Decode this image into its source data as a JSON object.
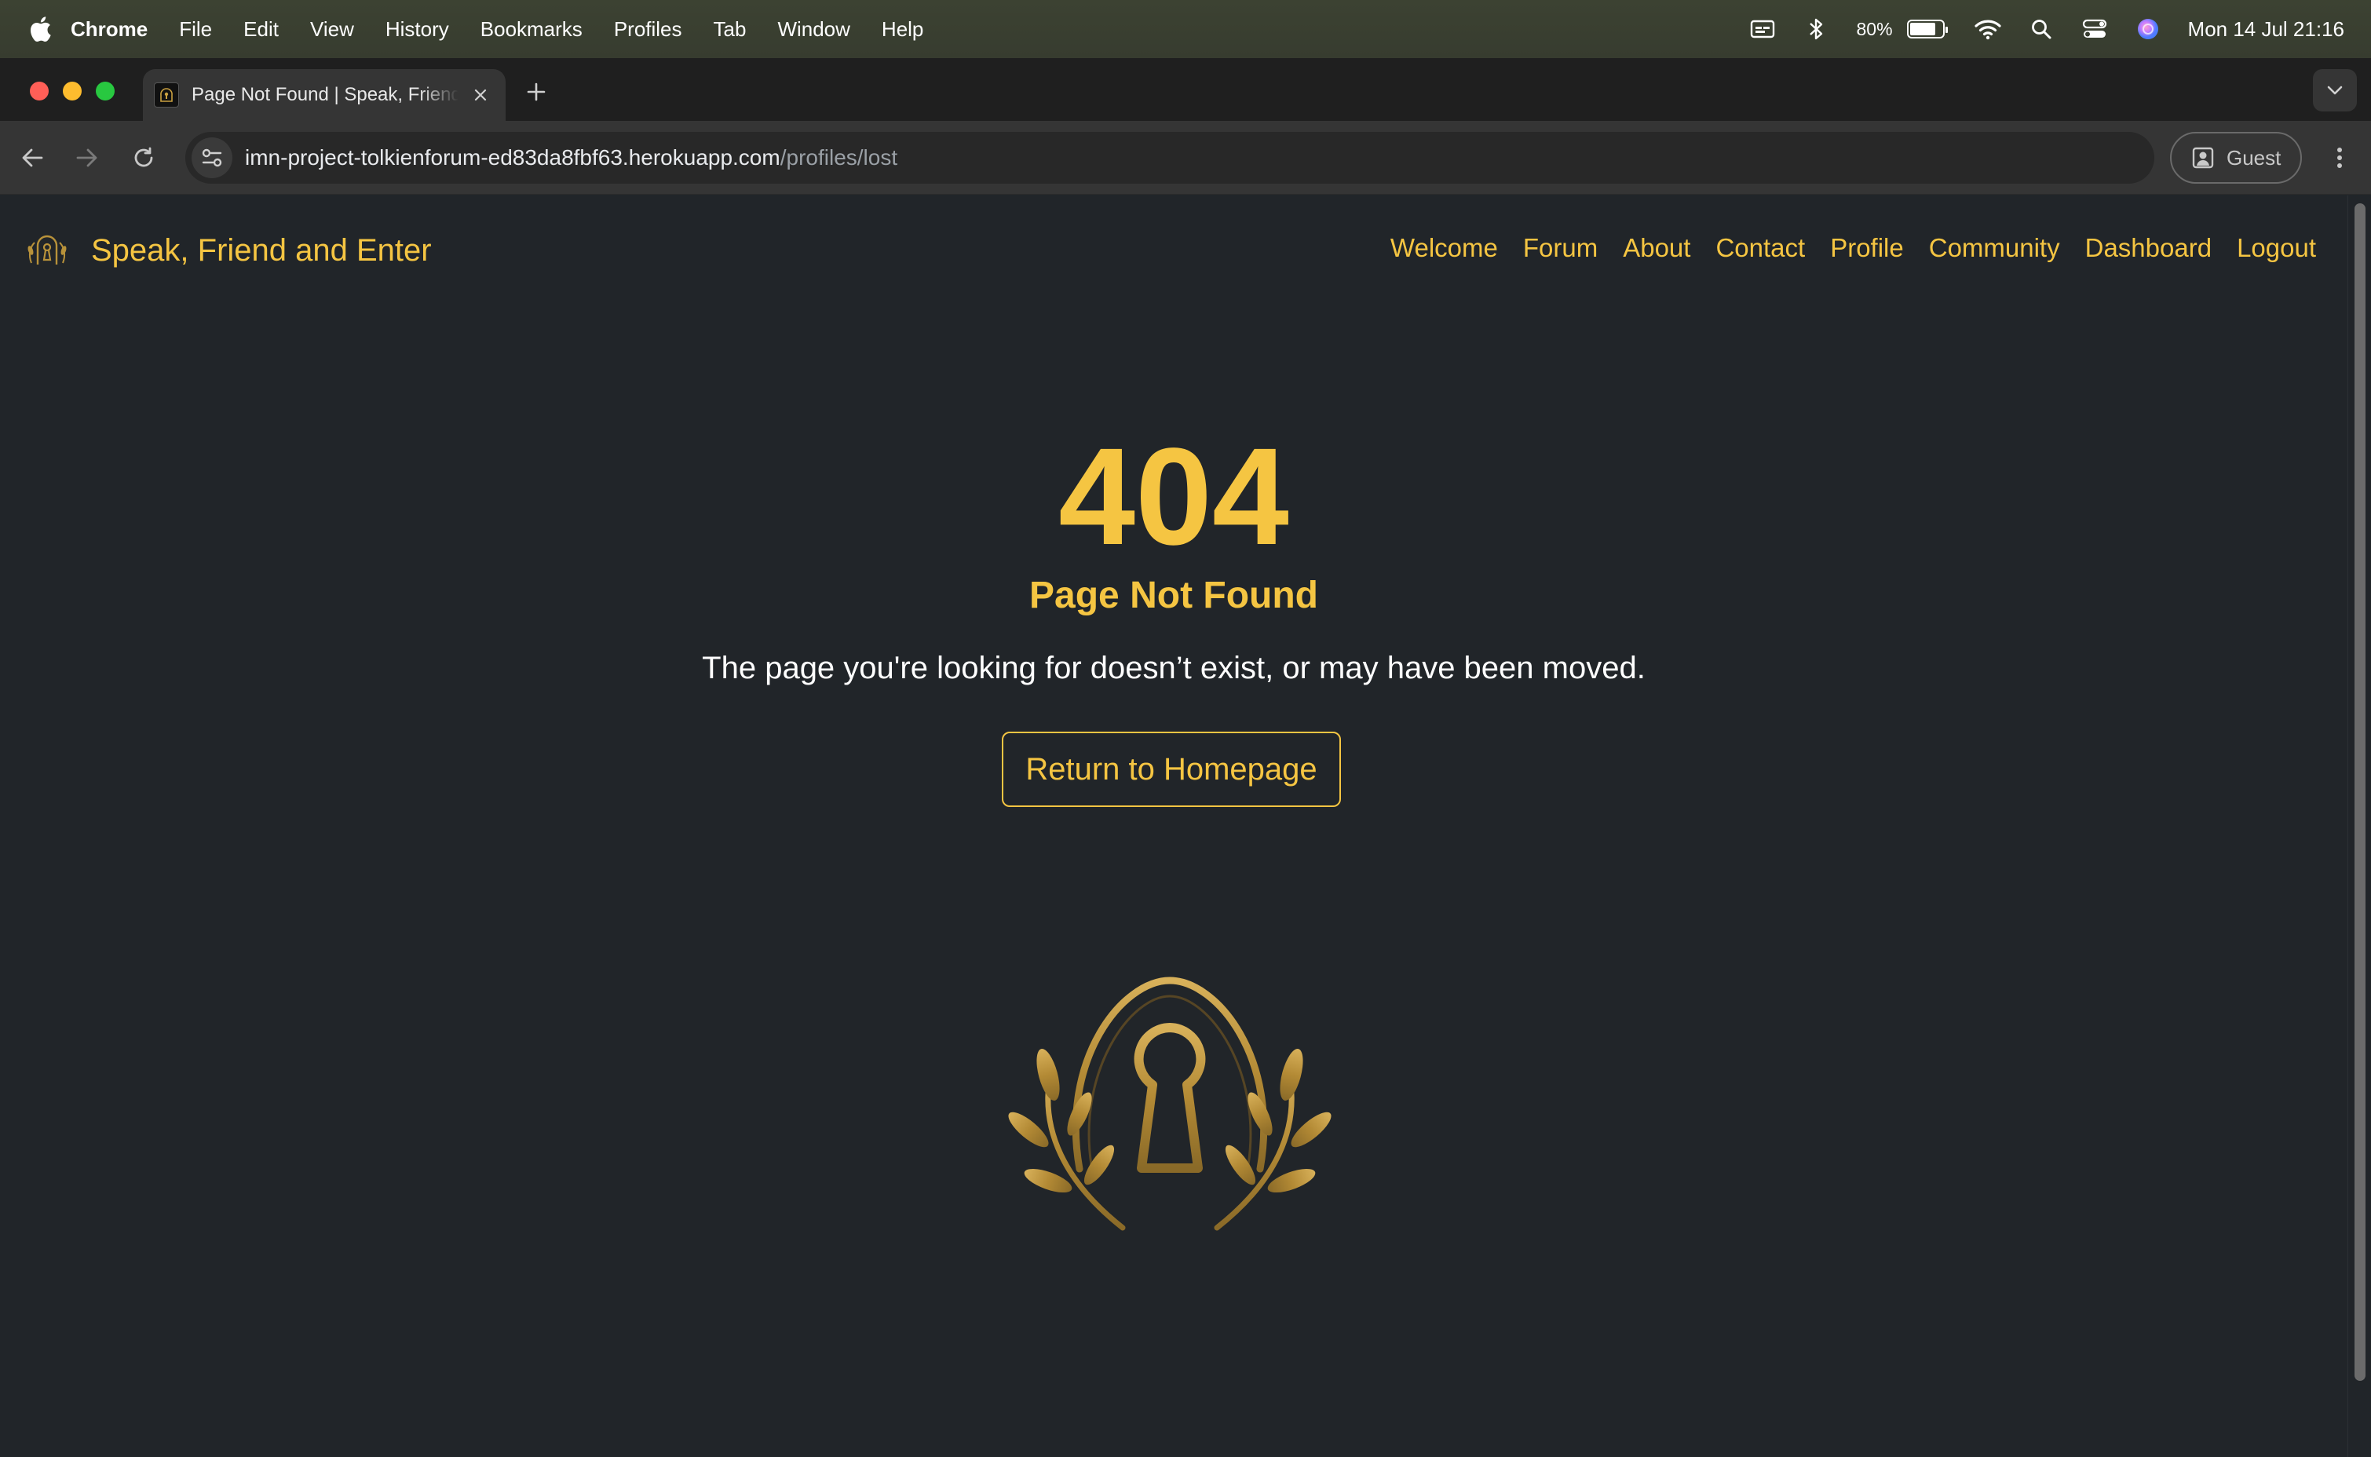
{
  "menubar": {
    "app": "Chrome",
    "items": [
      "File",
      "Edit",
      "View",
      "History",
      "Bookmarks",
      "Profiles",
      "Tab",
      "Window",
      "Help"
    ],
    "battery_percent": "80%",
    "battery_level": 0.8,
    "datetime": "Mon 14 Jul  21:16"
  },
  "browser": {
    "tab_title": "Page Not Found | Speak, Friend and Enter",
    "url_host": "imn-project-tolkienforum-ed83da8fbf63.herokuapp.com",
    "url_path": "/profiles/lost",
    "profile_label": "Guest"
  },
  "site": {
    "brand": "Speak, Friend and Enter",
    "nav": [
      "Welcome",
      "Forum",
      "About",
      "Contact",
      "Profile",
      "Community",
      "Dashboard",
      "Logout"
    ],
    "accent_color": "#f5c542",
    "background_color": "#212529"
  },
  "error": {
    "code": "404",
    "title": "Page Not Found",
    "message": "The page you're looking for doesn’t exist, or may have been moved.",
    "button_label": "Return to Homepage"
  }
}
